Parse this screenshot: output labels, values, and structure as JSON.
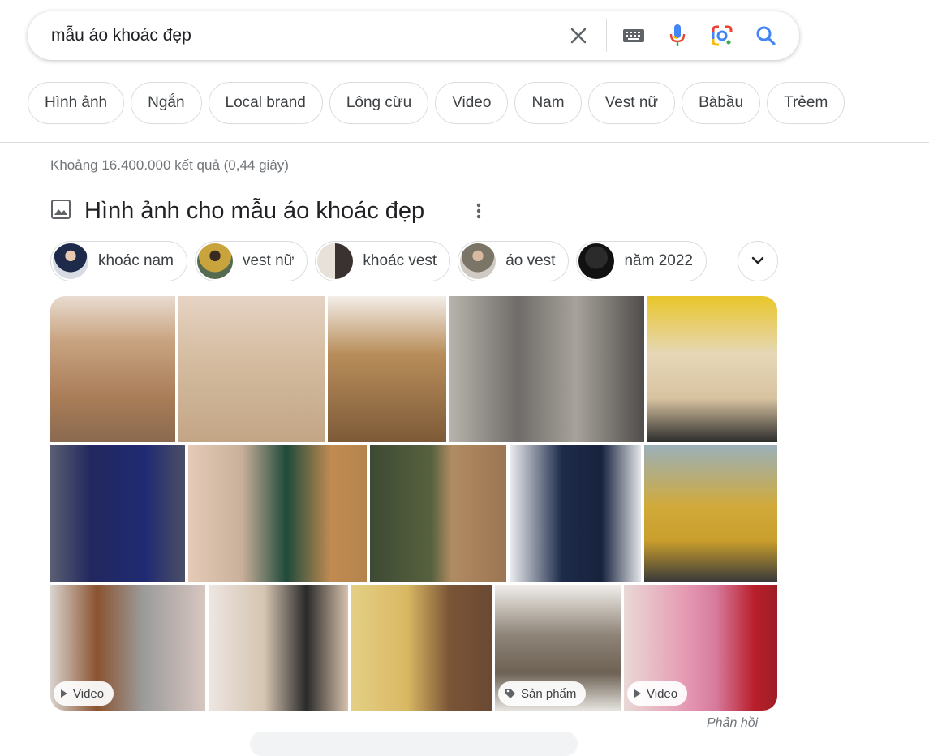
{
  "search": {
    "query": "mẫu áo khoác đẹp",
    "icons": [
      "close-icon",
      "keyboard-icon",
      "microphone-icon",
      "google-lens-icon",
      "search-icon"
    ]
  },
  "filters": [
    "Hình ảnh",
    "Ngắn",
    "Local brand",
    "Lông cừu",
    "Video",
    "Nam",
    "Vest nữ",
    "Bàbầu",
    "Trẻem"
  ],
  "result_stats": "Khoảng 16.400.000 kết quả (0,44 giây)",
  "images_section": {
    "title": "Hình ảnh cho mẫu áo khoác đẹp",
    "related": [
      "khoác nam",
      "vest nữ",
      "khoác vest",
      "áo vest",
      "năm 2022"
    ],
    "badges": {
      "video": "Video",
      "product": "Sản phẩm"
    },
    "feedback": "Phản hồi"
  },
  "colors": {
    "accent_blue": "#4285f4",
    "text_gray": "#70757a",
    "border": "#dadce0"
  }
}
